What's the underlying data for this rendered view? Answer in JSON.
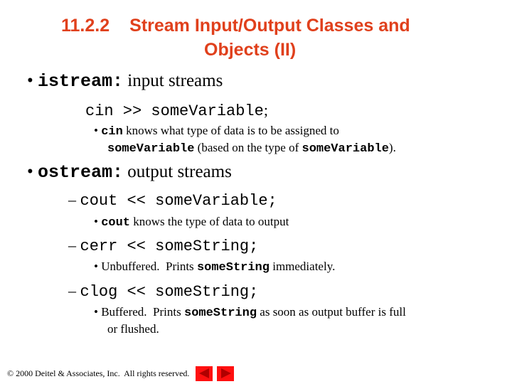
{
  "slide": {
    "title": {
      "number": "11.2.2",
      "line1": "Stream Input/Output Classes and",
      "line2": "Objects (II)"
    },
    "bullets": [
      {
        "marker": "•",
        "code": "istream:",
        "text": " input streams",
        "code_line": {
          "code": "cin >> someVariable",
          "suffix": ";"
        },
        "sub": {
          "marker": "•",
          "line1_code": "cin",
          "line1_text": " knows what type of data is to be assigned to",
          "line2_code1": "someVariable",
          "line2_text": " (based on the type of ",
          "line2_code2": "someVariable",
          "line2_end": ")."
        }
      },
      {
        "marker": "•",
        "code": "ostream:",
        "text": " output streams",
        "items": [
          {
            "marker": "–",
            "code": "cout << someVariable;",
            "sub": {
              "marker": "•",
              "code": "cout",
              "text": " knows the type of data to output"
            }
          },
          {
            "marker": "–",
            "code": "cerr << someString;",
            "sub": {
              "marker": "•",
              "pre": "Unbuffered.  Prints ",
              "code": "someString",
              "text": " immediately."
            }
          },
          {
            "marker": "–",
            "code": "clog << someString;",
            "sub": {
              "marker": "•",
              "pre": "Buffered.  Prints ",
              "code": "someString",
              "text": " as soon as output buffer is full",
              "line2": "or flushed."
            }
          }
        ]
      }
    ]
  },
  "footer": {
    "copyright": "© 2000 Deitel & Associates, Inc.  All rights reserved.",
    "prev_icon": "previous-slide-icon",
    "next_icon": "next-slide-icon"
  },
  "colors": {
    "title": "#e0401c",
    "nav_button": "#ff1010",
    "nav_arrow": "#b00000"
  }
}
